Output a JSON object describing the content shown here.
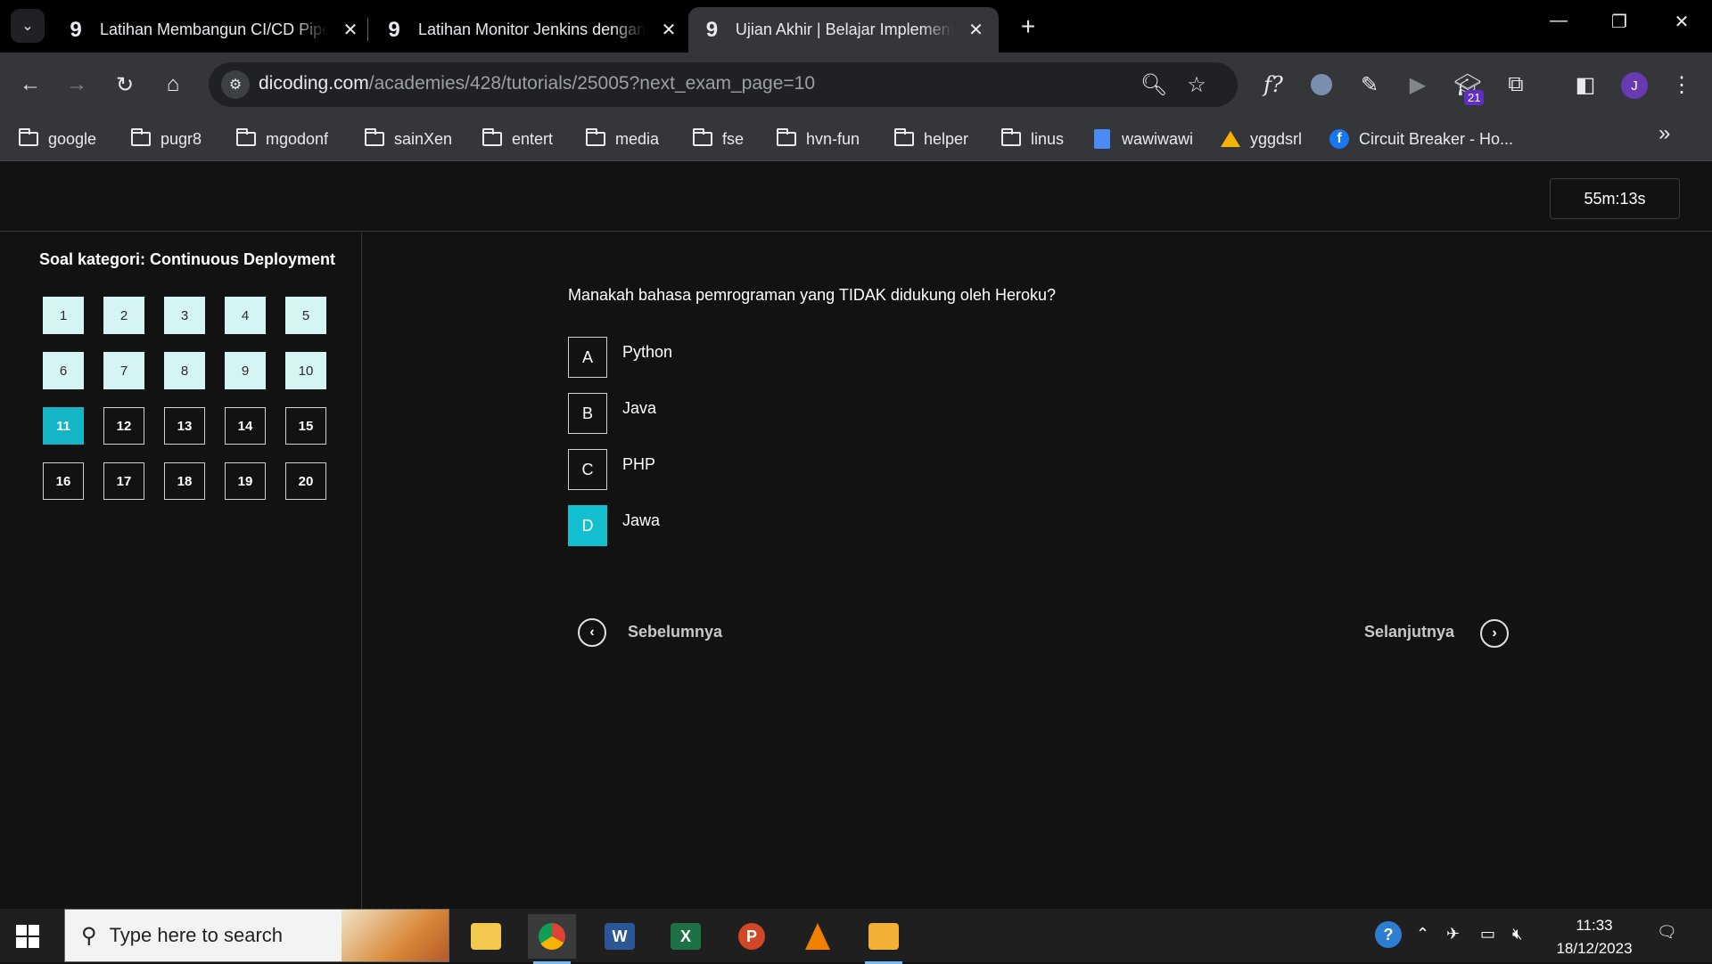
{
  "browser": {
    "tabs": [
      {
        "title": "Latihan Membangun CI/CD Pipe",
        "favicon": "9"
      },
      {
        "title": "Latihan Monitor Jenkins dengan",
        "favicon": "9"
      },
      {
        "title": "Ujian Akhir | Belajar Implementa",
        "favicon": "9"
      }
    ],
    "address": {
      "host": "dicoding.com",
      "path": "/academies/428/tutorials/25005?next_exam_page=10"
    },
    "extension_badge": "21",
    "profile_initial": "J",
    "bookmarks": [
      "google",
      "pugr8",
      "mgodonf",
      "sainXen",
      "entert",
      "media",
      "fse",
      "hvn-fun",
      "helper",
      "linus",
      "wawiwawi",
      "yggdsrl",
      "Circuit Breaker - Ho..."
    ]
  },
  "exam": {
    "timer": "55m:13s",
    "category_title": "Soal kategori: Continuous Deployment",
    "questions": [
      {
        "number": "1",
        "state": "answered"
      },
      {
        "number": "2",
        "state": "answered"
      },
      {
        "number": "3",
        "state": "answered"
      },
      {
        "number": "4",
        "state": "answered"
      },
      {
        "number": "5",
        "state": "answered"
      },
      {
        "number": "6",
        "state": "answered"
      },
      {
        "number": "7",
        "state": "answered"
      },
      {
        "number": "8",
        "state": "answered"
      },
      {
        "number": "9",
        "state": "answered"
      },
      {
        "number": "10",
        "state": "answered"
      },
      {
        "number": "11",
        "state": "current"
      },
      {
        "number": "12",
        "state": "unanswered"
      },
      {
        "number": "13",
        "state": "unanswered"
      },
      {
        "number": "14",
        "state": "unanswered"
      },
      {
        "number": "15",
        "state": "unanswered"
      },
      {
        "number": "16",
        "state": "unanswered"
      },
      {
        "number": "17",
        "state": "unanswered"
      },
      {
        "number": "18",
        "state": "unanswered"
      },
      {
        "number": "19",
        "state": "unanswered"
      },
      {
        "number": "20",
        "state": "unanswered"
      }
    ],
    "question_text": "Manakah bahasa pemrograman yang TIDAK didukung oleh Heroku?",
    "options": [
      {
        "letter": "A",
        "text": "Python",
        "selected": false
      },
      {
        "letter": "B",
        "text": "Java",
        "selected": false
      },
      {
        "letter": "C",
        "text": "PHP",
        "selected": false
      },
      {
        "letter": "D",
        "text": "Jawa",
        "selected": true
      }
    ],
    "prev_label": "Sebelumnya",
    "next_label": "Selanjutnya"
  },
  "taskbar": {
    "search_placeholder": "Type here to search",
    "time": "11:33",
    "date": "18/12/2023"
  },
  "colors": {
    "accent": "#13b5c6",
    "answered_bg": "#d5f4f4",
    "page_bg": "#121212"
  }
}
